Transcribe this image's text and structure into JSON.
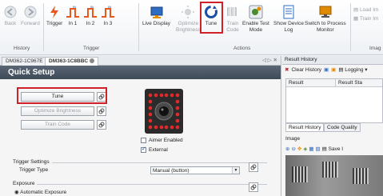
{
  "ribbon": {
    "buttons": [
      {
        "id": "back",
        "label": "Back"
      },
      {
        "id": "forward",
        "label": "Forward"
      },
      {
        "id": "trigger",
        "label": "Trigger"
      },
      {
        "id": "in1",
        "label": "In 1"
      },
      {
        "id": "in2",
        "label": "In 2"
      },
      {
        "id": "in3",
        "label": "In 3"
      },
      {
        "id": "live",
        "label": "Live Display"
      },
      {
        "id": "optimize",
        "label": "Optimize\nBrightness"
      },
      {
        "id": "tune",
        "label": "Tune"
      },
      {
        "id": "traincode",
        "label": "Train\nCode"
      },
      {
        "id": "enabletest",
        "label": "Enable Test\nMode"
      },
      {
        "id": "showlog",
        "label": "Show Device\nLog"
      },
      {
        "id": "switchmon",
        "label": "Switch to Process\nMonitor"
      }
    ],
    "right_items": [
      "Load Im",
      "Train Im"
    ],
    "groups": {
      "history": "History",
      "trigger": "Trigger",
      "actions": "Actions",
      "image": "Imag"
    },
    "in_superscript": "IN",
    "colors": {
      "accent_red": "#d0202a",
      "trigger_orange": "#e8571c"
    }
  },
  "tabs": {
    "items": [
      {
        "label": "DM362-1C967E"
      },
      {
        "label": "DM363-1C8BBC"
      }
    ],
    "controls": "◁ ▷ ✕"
  },
  "quick_setup": {
    "title": "Quick Setup",
    "buttons": {
      "tune": "Tune",
      "optimize": "Optimize Brightness",
      "train": "Train Code"
    },
    "checkboxes": [
      {
        "label": "Aimer Enabled",
        "checked": false
      },
      {
        "label": "External",
        "checked": true
      }
    ],
    "trigger_settings": {
      "legend": "Trigger Settings",
      "label": "Trigger Type",
      "value": "Manual (button)"
    },
    "exposure": {
      "legend": "Exposure",
      "option": "Automatic Exposure"
    }
  },
  "result_history": {
    "title": "Result History",
    "clear_label": "Clear History",
    "logging_label": "Logging",
    "columns": [
      "Result",
      "Result Sta"
    ],
    "tabs": [
      "Result History",
      "Code Quality"
    ]
  },
  "image_panel": {
    "title": "Image",
    "save_label": "Save I"
  }
}
